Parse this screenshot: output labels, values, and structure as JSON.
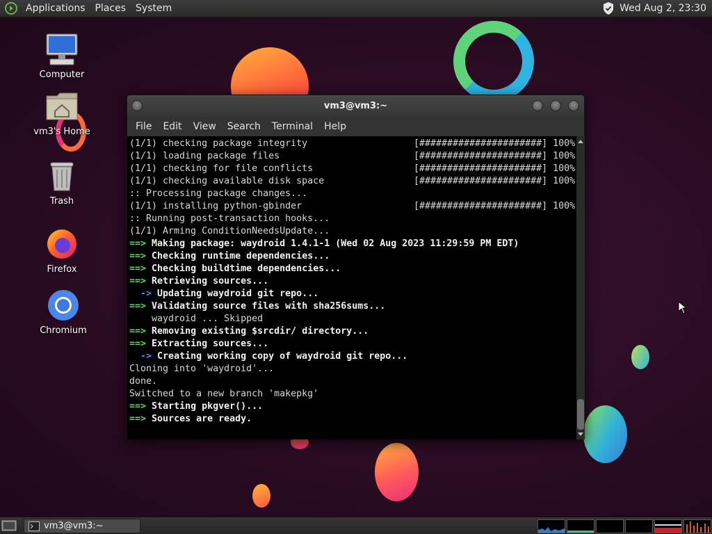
{
  "top_panel": {
    "menus": [
      "Applications",
      "Places",
      "System"
    ],
    "clock": "Wed Aug  2, 23:30",
    "tray_icon": "shield-icon"
  },
  "desktop_icons": [
    {
      "label": "Computer",
      "icon": "computer-icon"
    },
    {
      "label": "vm3's Home",
      "icon": "home-folder-icon"
    },
    {
      "label": "Trash",
      "icon": "trash-icon"
    },
    {
      "label": "Firefox",
      "icon": "firefox-icon"
    },
    {
      "label": "Chromium",
      "icon": "chromium-icon"
    }
  ],
  "terminal": {
    "title": "vm3@vm3:~",
    "menus": [
      "File",
      "Edit",
      "View",
      "Search",
      "Terminal",
      "Help"
    ],
    "lines": [
      {
        "type": "plain",
        "text": "(1/1) checking package integrity",
        "progress": "[######################] 100%"
      },
      {
        "type": "plain",
        "text": "(1/1) loading package files",
        "progress": "[######################] 100%"
      },
      {
        "type": "plain",
        "text": "(1/1) checking for file conflicts",
        "progress": "[######################] 100%"
      },
      {
        "type": "plain",
        "text": "(1/1) checking available disk space",
        "progress": "[######################] 100%"
      },
      {
        "type": "plain",
        "text": ":: Processing package changes...",
        "progress": ""
      },
      {
        "type": "plain",
        "text": "(1/1) installing python-gbinder",
        "progress": "[######################] 100%"
      },
      {
        "type": "plain",
        "text": ":: Running post-transaction hooks...",
        "progress": ""
      },
      {
        "type": "plain",
        "text": "(1/1) Arming ConditionNeedsUpdate...",
        "progress": ""
      },
      {
        "type": "main",
        "text": "Making package: waydroid 1.4.1-1 (Wed 02 Aug 2023 11:29:59 PM EDT)"
      },
      {
        "type": "main",
        "text": "Checking runtime dependencies..."
      },
      {
        "type": "main",
        "text": "Checking buildtime dependencies..."
      },
      {
        "type": "main",
        "text": "Retrieving sources..."
      },
      {
        "type": "sub",
        "text": "Updating waydroid git repo..."
      },
      {
        "type": "main",
        "text": "Validating source files with sha256sums..."
      },
      {
        "type": "plain",
        "text": "    waydroid ... Skipped",
        "progress": ""
      },
      {
        "type": "main",
        "text": "Removing existing $srcdir/ directory..."
      },
      {
        "type": "main",
        "text": "Extracting sources..."
      },
      {
        "type": "sub",
        "text": "Creating working copy of waydroid git repo..."
      },
      {
        "type": "plain",
        "text": "Cloning into 'waydroid'...",
        "progress": ""
      },
      {
        "type": "plain",
        "text": "done.",
        "progress": ""
      },
      {
        "type": "plain",
        "text": "Switched to a new branch 'makepkg'",
        "progress": ""
      },
      {
        "type": "main",
        "text": "Starting pkgver()..."
      },
      {
        "type": "main",
        "text": "Sources are ready."
      }
    ],
    "arrow_main": "==>",
    "arrow_sub": "  ->"
  },
  "taskbar": {
    "task_label": "vm3@vm3:~"
  },
  "colors": {
    "arrow_green": "#5fd75f",
    "sub_arrow_blue": "#5f87ff"
  }
}
